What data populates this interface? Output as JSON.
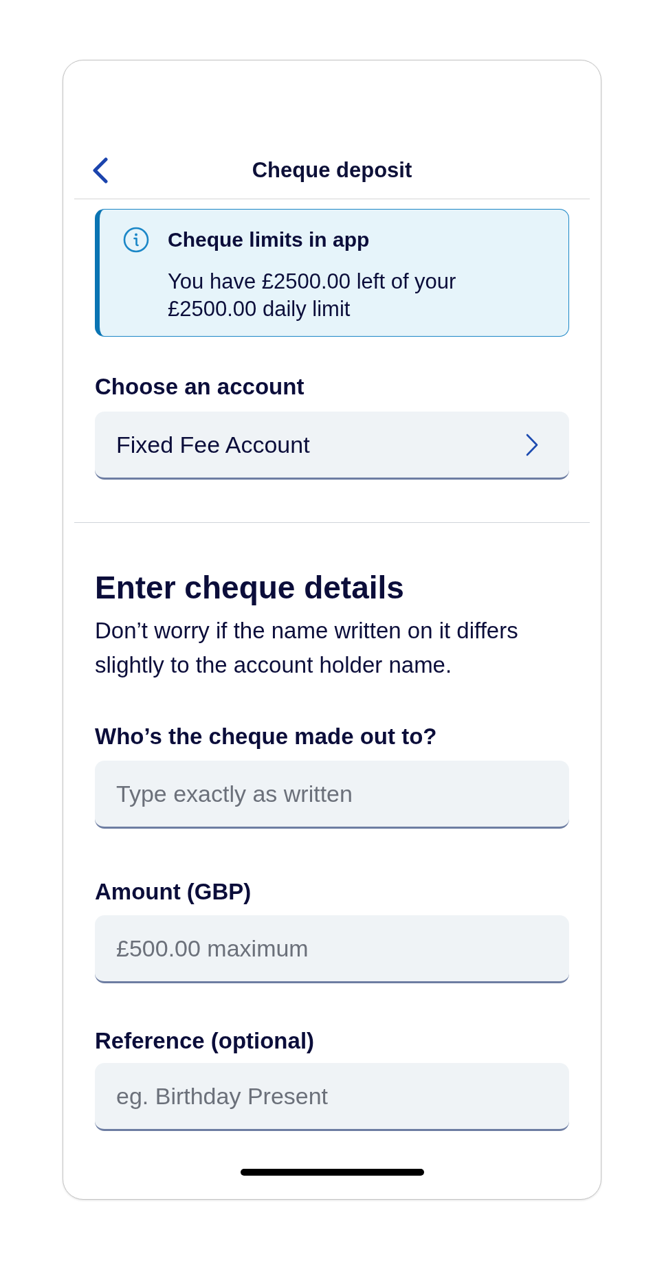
{
  "header": {
    "title": "Cheque deposit"
  },
  "notice": {
    "title": "Cheque limits in app",
    "body": "You have £2500.00 left of your £2500.00 daily limit"
  },
  "account": {
    "label": "Choose an account",
    "value": "Fixed Fee Account"
  },
  "details": {
    "heading": "Enter cheque details",
    "description": "Don’t worry if the name written on it differs slightly to the account holder name.",
    "fields": [
      {
        "label": "Who’s the cheque made out to?",
        "placeholder": "Type exactly as written"
      },
      {
        "label": "Amount (GBP)",
        "placeholder": "£500.00 maximum"
      },
      {
        "label": "Reference (optional)",
        "placeholder": "eg. Birthday Present"
      }
    ]
  }
}
